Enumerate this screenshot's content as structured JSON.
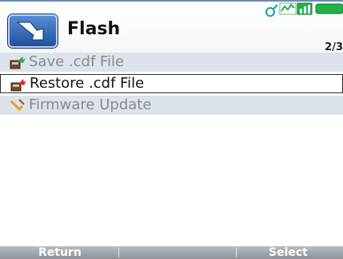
{
  "header": {
    "title": "Flash",
    "page_counter": "2/3"
  },
  "menu": {
    "items": [
      {
        "label": "Save .cdf File",
        "icon": "save-file-icon",
        "state": "disabled"
      },
      {
        "label": "Restore .cdf File",
        "icon": "restore-file-icon",
        "state": "selected"
      },
      {
        "label": "Firmware Update",
        "icon": "firmware-update-icon",
        "state": "disabled"
      }
    ]
  },
  "softkeys": {
    "left": "Return",
    "right": "Select"
  },
  "colors": {
    "header_border": "#6a8bb0",
    "menu_item_bg": "#dde3ea",
    "selected_item_bg": "#ffffff",
    "softkey_bar": "#8c9297",
    "status_green": "#22b24c"
  }
}
